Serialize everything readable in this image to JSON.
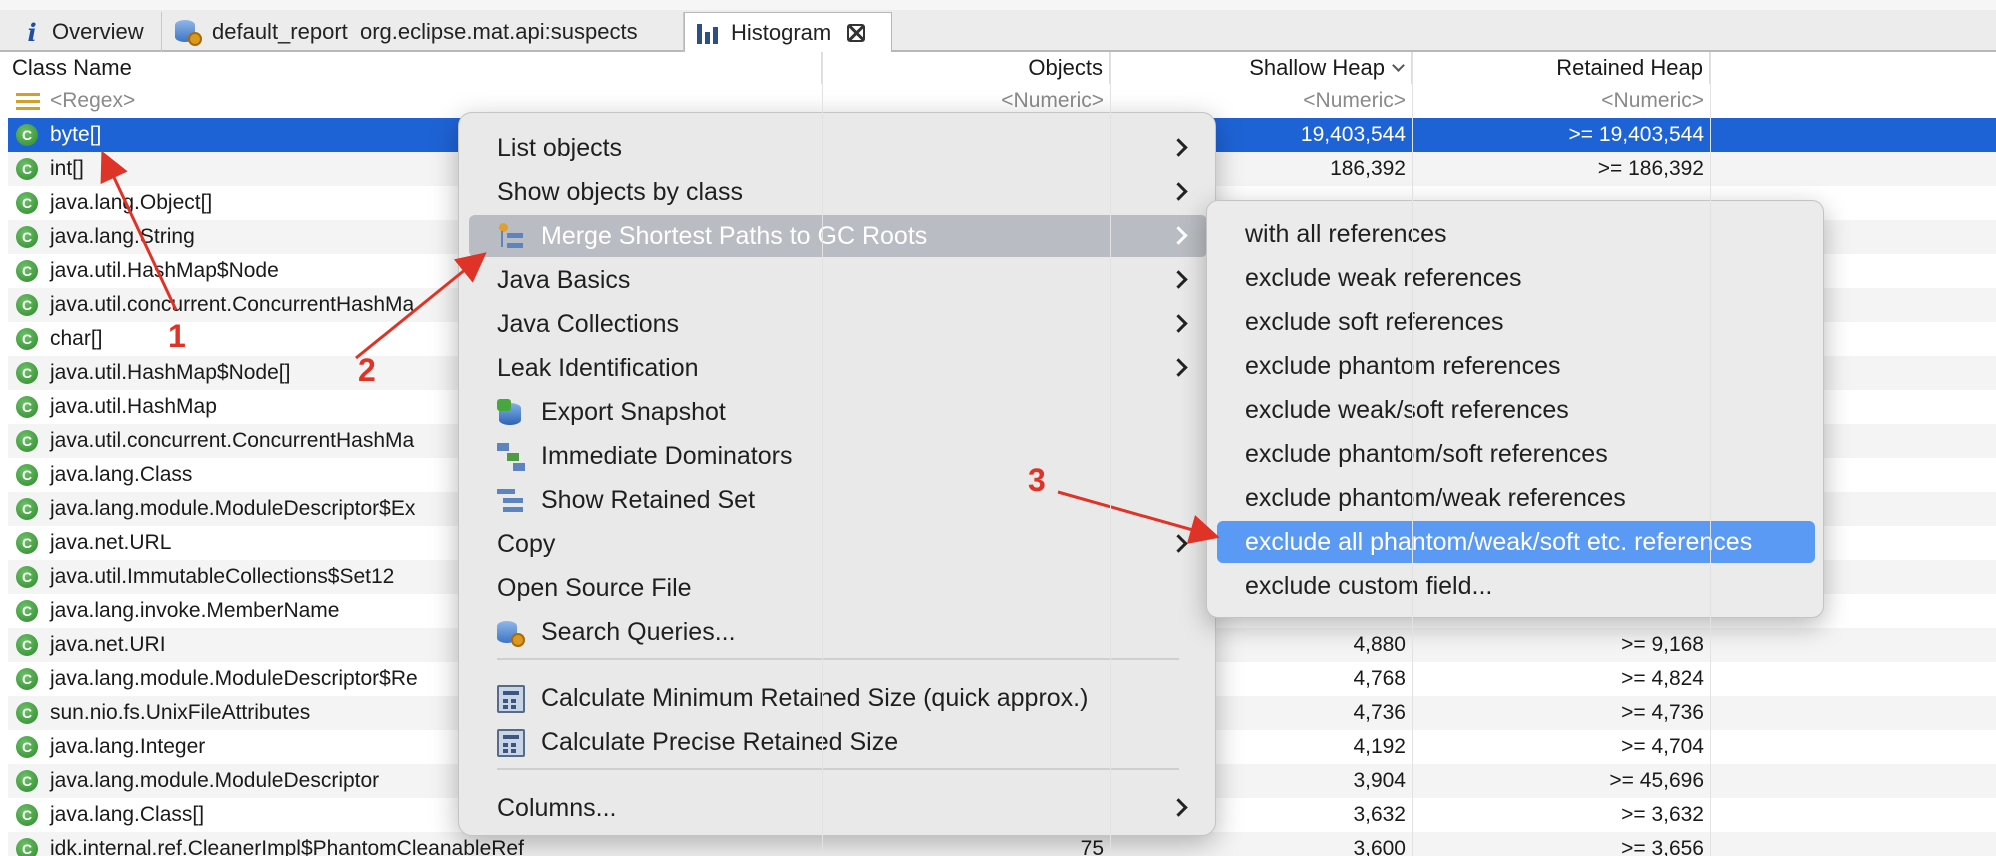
{
  "tabs": [
    {
      "label": "Overview",
      "icon": "info-icon"
    },
    {
      "label": "default_report  org.eclipse.mat.api:suspects",
      "icon": "database-gear-icon"
    },
    {
      "label": "Histogram",
      "icon": "histogram-icon"
    }
  ],
  "table": {
    "headers": {
      "name": "Class Name",
      "objects": "Objects",
      "shallow": "Shallow Heap",
      "retained": "Retained Heap"
    },
    "filter": {
      "name": "<Regex>",
      "objects": "<Numeric>",
      "shallow": "<Numeric>",
      "retained": "<Numeric>"
    },
    "rows": [
      {
        "name": "byte[]",
        "objects": "",
        "shallow": "19,403,544",
        "retained": ">= 19,403,544"
      },
      {
        "name": "int[]",
        "objects": "",
        "shallow": "186,392",
        "retained": ">= 186,392"
      },
      {
        "name": "java.lang.Object[]",
        "objects": "",
        "shallow": "",
        "retained": ""
      },
      {
        "name": "java.lang.String",
        "objects": "",
        "shallow": "",
        "retained": ""
      },
      {
        "name": "java.util.HashMap$Node",
        "objects": "",
        "shallow": "",
        "retained": ""
      },
      {
        "name": "java.util.concurrent.ConcurrentHashMa",
        "objects": "",
        "shallow": "",
        "retained": ""
      },
      {
        "name": "char[]",
        "objects": "",
        "shallow": "",
        "retained": ""
      },
      {
        "name": "java.util.HashMap$Node[]",
        "objects": "",
        "shallow": "",
        "retained": ""
      },
      {
        "name": "java.util.HashMap",
        "objects": "",
        "shallow": "",
        "retained": ""
      },
      {
        "name": "java.util.concurrent.ConcurrentHashMa",
        "objects": "",
        "shallow": "",
        "retained": ""
      },
      {
        "name": "java.lang.Class",
        "objects": "",
        "shallow": "",
        "retained": ""
      },
      {
        "name": "java.lang.module.ModuleDescriptor$Ex",
        "objects": "",
        "shallow": "",
        "retained": ""
      },
      {
        "name": "java.net.URL",
        "objects": "",
        "shallow": "",
        "retained": ""
      },
      {
        "name": "java.util.ImmutableCollections$Set12",
        "objects": "",
        "shallow": "",
        "retained": ""
      },
      {
        "name": "java.lang.invoke.MemberName",
        "objects": "",
        "shallow": "",
        "retained": ""
      },
      {
        "name": "java.net.URI",
        "objects": "",
        "shallow": "4,880",
        "retained": ">= 9,168"
      },
      {
        "name": "java.lang.module.ModuleDescriptor$Re",
        "objects": "",
        "shallow": "4,768",
        "retained": ">= 4,824"
      },
      {
        "name": "sun.nio.fs.UnixFileAttributes",
        "objects": "",
        "shallow": "4,736",
        "retained": ">= 4,736"
      },
      {
        "name": "java.lang.Integer",
        "objects": "",
        "shallow": "4,192",
        "retained": ">= 4,704"
      },
      {
        "name": "java.lang.module.ModuleDescriptor",
        "objects": "",
        "shallow": "3,904",
        "retained": ">= 45,696"
      },
      {
        "name": "java.lang.Class[]",
        "objects": "",
        "shallow": "3,632",
        "retained": ">= 3,632"
      },
      {
        "name": "idk.internal.ref.CleanerImpl$PhantomCleanableRef",
        "objects": "75",
        "shallow": "3,600",
        "retained": ">= 3,656"
      }
    ]
  },
  "context_menu": {
    "items": [
      {
        "label": "List objects",
        "submenu": true,
        "icon": ""
      },
      {
        "label": "Show objects by class",
        "submenu": true,
        "icon": ""
      },
      {
        "label": "Merge Shortest Paths to GC Roots",
        "submenu": true,
        "icon": "merge-paths-icon"
      },
      {
        "label": "Java Basics",
        "submenu": true,
        "icon": ""
      },
      {
        "label": "Java Collections",
        "submenu": true,
        "icon": ""
      },
      {
        "label": "Leak Identification",
        "submenu": true,
        "icon": ""
      },
      {
        "label": "Export Snapshot",
        "submenu": false,
        "icon": "export-snapshot-icon"
      },
      {
        "label": "Immediate Dominators",
        "submenu": false,
        "icon": "dominators-icon"
      },
      {
        "label": "Show Retained Set",
        "submenu": false,
        "icon": "retained-set-icon"
      },
      {
        "label": "Copy",
        "submenu": true,
        "icon": ""
      },
      {
        "label": "Open Source File",
        "submenu": false,
        "icon": ""
      },
      {
        "label": "Search Queries...",
        "submenu": false,
        "icon": "search-queries-icon"
      },
      {
        "label": "Calculate Minimum Retained Size (quick approx.)",
        "submenu": false,
        "icon": "calculator-icon"
      },
      {
        "label": "Calculate Precise Retained Size",
        "submenu": false,
        "icon": "calculator-icon"
      },
      {
        "label": "Columns...",
        "submenu": true,
        "icon": ""
      }
    ]
  },
  "submenu": {
    "items": [
      "with all references",
      "exclude weak references",
      "exclude soft references",
      "exclude phantom references",
      "exclude weak/soft references",
      "exclude phantom/soft references",
      "exclude phantom/weak references",
      "exclude all phantom/weak/soft etc. references",
      "exclude custom field..."
    ]
  },
  "annotations": [
    "1",
    "2",
    "3"
  ],
  "colors": {
    "selection": "#1e63d6",
    "submenu_highlight": "#5a9af4",
    "annotation": "#e03327"
  }
}
